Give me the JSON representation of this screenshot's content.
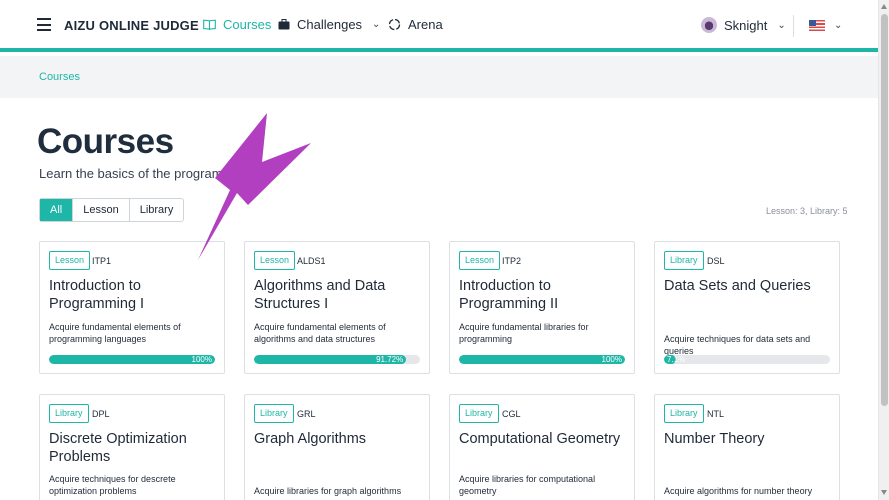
{
  "nav": {
    "brand": "AIZU ONLINE JUDGE",
    "courses": "Courses",
    "challenges": "Challenges",
    "arena": "Arena",
    "user": "Sknight",
    "icons": [
      "hamburger-menu-icon",
      "book-icon",
      "briefcase-icon",
      "refresh-icon",
      "chevron-down-icon",
      "us-flag-icon"
    ]
  },
  "breadcrumb": {
    "current": "Courses"
  },
  "page": {
    "title": "Courses",
    "subtitle": "Learn the basics of the program"
  },
  "filters": {
    "all": "All",
    "lesson": "Lesson",
    "library": "Library",
    "selected": "All"
  },
  "counts": "Lesson: 3, Library: 5",
  "colors": {
    "accent": "#1eb6a7",
    "arrow": "#b13fbf"
  },
  "cards": [
    {
      "type": "Lesson",
      "code": "ITP1",
      "title": "Introduction to Programming I",
      "desc": "Acquire fundamental elements of programming languages",
      "progress_label": "100%",
      "progress": 1.0
    },
    {
      "type": "Lesson",
      "code": "ALDS1",
      "title": "Algorithms and Data Structures I",
      "desc": "Acquire fundamental elements of algorithms and data structures",
      "progress_label": "91.72%",
      "progress": 0.9172
    },
    {
      "type": "Lesson",
      "code": "ITP2",
      "title": "Introduction to Programming II",
      "desc": "Acquire fundamental libraries for programming",
      "progress_label": "100%",
      "progress": 1.0
    },
    {
      "type": "Library",
      "code": "DSL",
      "title": "Data Sets and Queries",
      "desc": "Acquire techniques for data sets and queries",
      "progress_label": "7.1%",
      "progress": 0.071
    },
    {
      "type": "Library",
      "code": "DPL",
      "title": "Discrete Optimization Problems",
      "desc": "Acquire techniques for descrete optimization problems"
    },
    {
      "type": "Library",
      "code": "GRL",
      "title": "Graph Algorithms",
      "desc": "Acquire libraries for graph algorithms"
    },
    {
      "type": "Library",
      "code": "CGL",
      "title": "Computational Geometry",
      "desc": "Acquire libraries for computational geometry"
    },
    {
      "type": "Library",
      "code": "NTL",
      "title": "Number Theory",
      "desc": "Acquire algorithms for number theory"
    }
  ]
}
